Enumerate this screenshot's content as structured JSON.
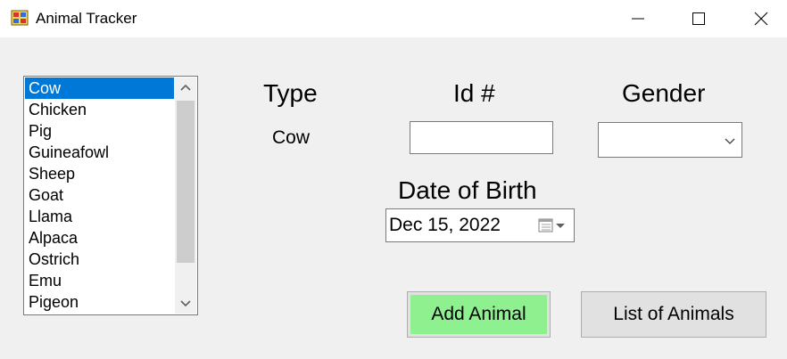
{
  "window": {
    "title": "Animal Tracker",
    "icons": {
      "app": "app-icon",
      "minimize": "minimize-icon",
      "maximize": "maximize-icon",
      "close": "close-icon"
    }
  },
  "animal_list": {
    "items": [
      "Cow",
      "Chicken",
      "Pig",
      "Guineafowl",
      "Sheep",
      "Goat",
      "Llama",
      "Alpaca",
      "Ostrich",
      "Emu",
      "Pigeon"
    ],
    "selected": "Cow",
    "selected_color": "#0078d7"
  },
  "form": {
    "type_label": "Type",
    "type_value": "Cow",
    "id_label": "Id #",
    "id_value": "",
    "gender_label": "Gender",
    "gender_value": "",
    "dob_label": "Date of Birth",
    "dob_value": "Dec 15, 2022"
  },
  "buttons": {
    "add_animal": "Add Animal",
    "add_animal_color": "#8ff08f",
    "list_animals": "List of Animals"
  }
}
